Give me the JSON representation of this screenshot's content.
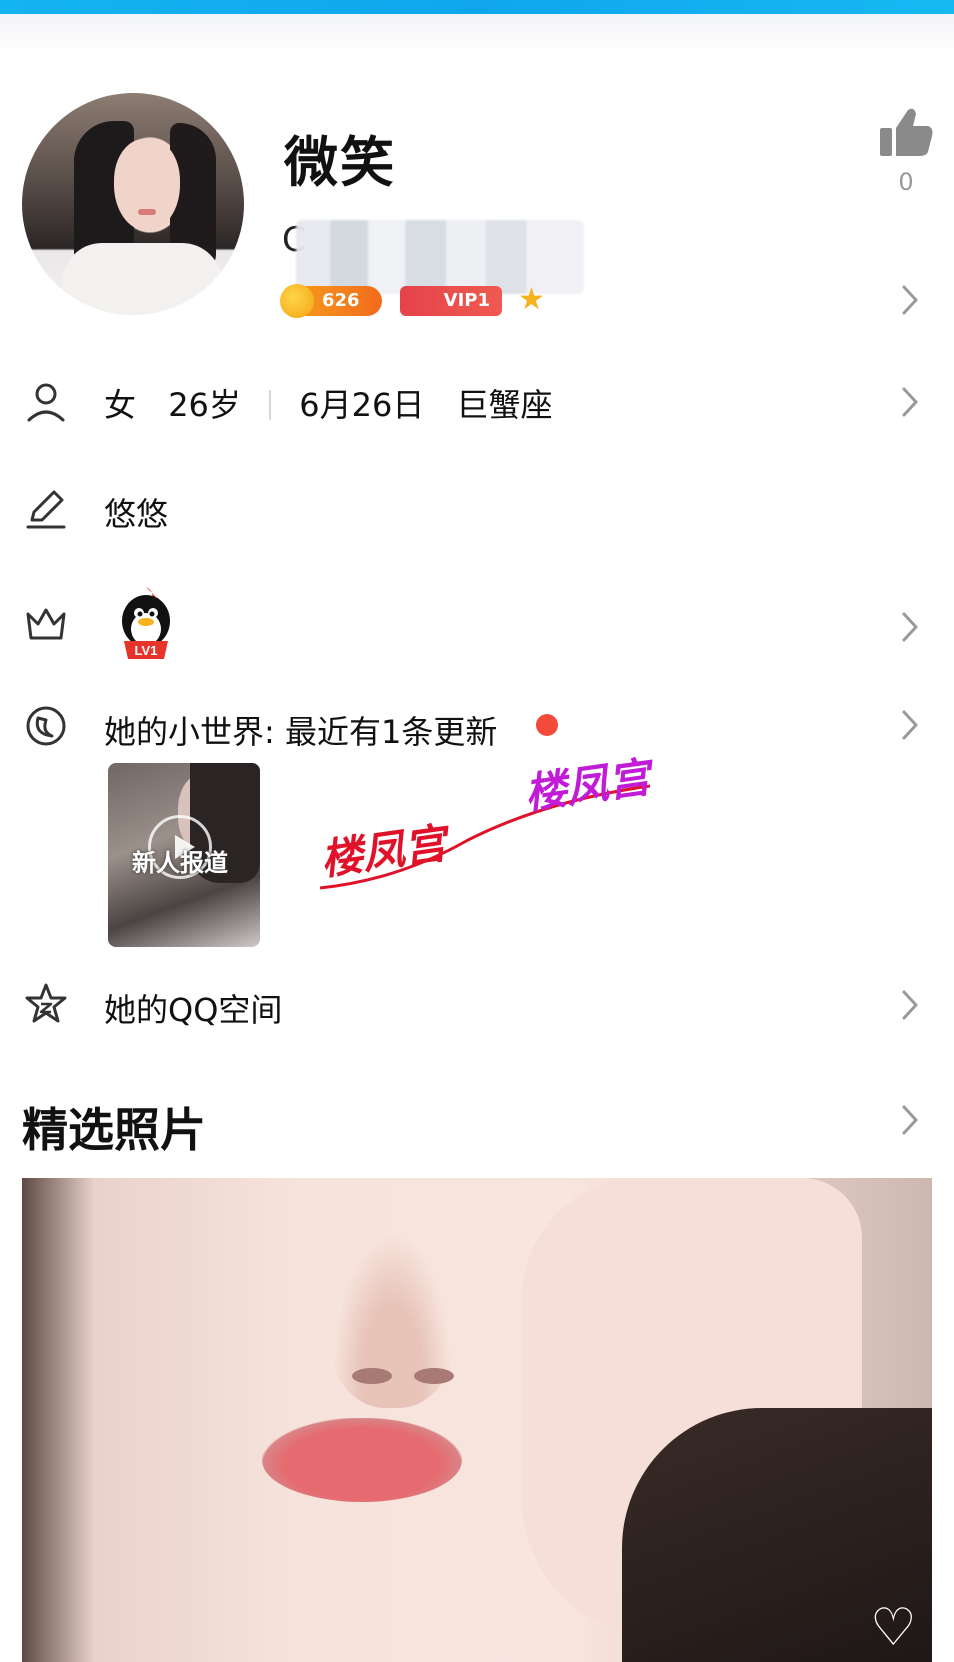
{
  "profile": {
    "name": "微笑",
    "qq_prefix": "C",
    "coin_badge": "626",
    "vip_badge": "VIP1",
    "likes": "0"
  },
  "info": {
    "gender": "女",
    "age": "26岁",
    "birthday": "6月26日",
    "zodiac": "巨蟹座",
    "signature": "悠悠",
    "level_badge": "LV1"
  },
  "world": {
    "label": "她的小世界: 最近有1条更新",
    "thumb_caption": "新人报道"
  },
  "qzone": {
    "label": "她的QQ空间"
  },
  "watermarks": [
    "楼凤宫",
    "楼凤宫"
  ],
  "photos_section": {
    "title": "精选照片"
  },
  "icons": {
    "gender": "person-icon",
    "signature": "pencil-icon",
    "level": "crown-icon",
    "world": "moon-icon",
    "qzone": "qzone-star-icon",
    "like": "thumbs-up-icon",
    "chevron": "chevron-right-icon"
  },
  "colors": {
    "topbar": "#14b4f0",
    "red_dot": "#f24b3c",
    "watermark_red": "#e0122a",
    "watermark_purple": "#c21bd8"
  }
}
